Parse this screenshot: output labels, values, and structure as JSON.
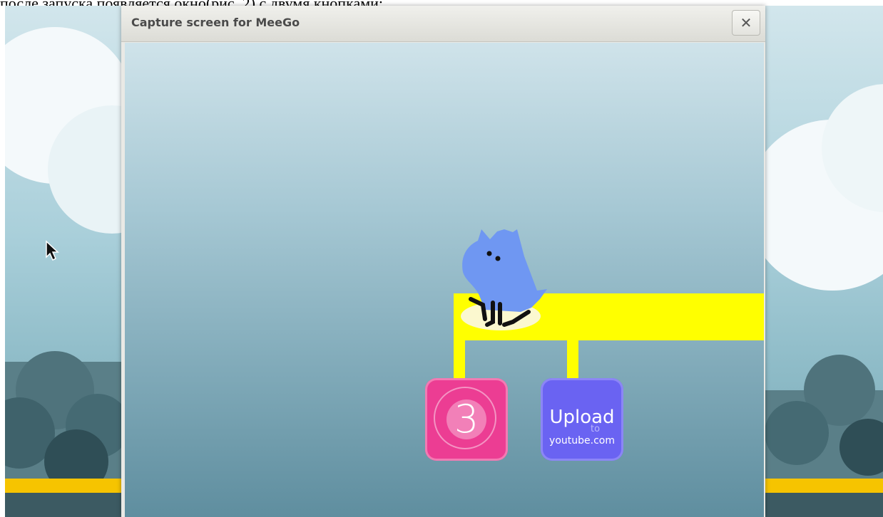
{
  "caption": "после запуска появляется окно(рис. 2) с двумя кнопками:",
  "window": {
    "title": "Capture screen for MeeGo",
    "close_symbol": "✕"
  },
  "record_button": {
    "countdown": "3",
    "color": "#ec3d93"
  },
  "upload_button": {
    "line1": "Upload",
    "line2": "to",
    "line3": "youtube.com",
    "color": "#6a63f2"
  },
  "colors": {
    "platform": "#ffff00",
    "character": "#6f97f2",
    "accent_stripe": "#f6c400"
  },
  "icons": [
    "mouse-pointer-icon",
    "close-icon",
    "character-illustration"
  ]
}
